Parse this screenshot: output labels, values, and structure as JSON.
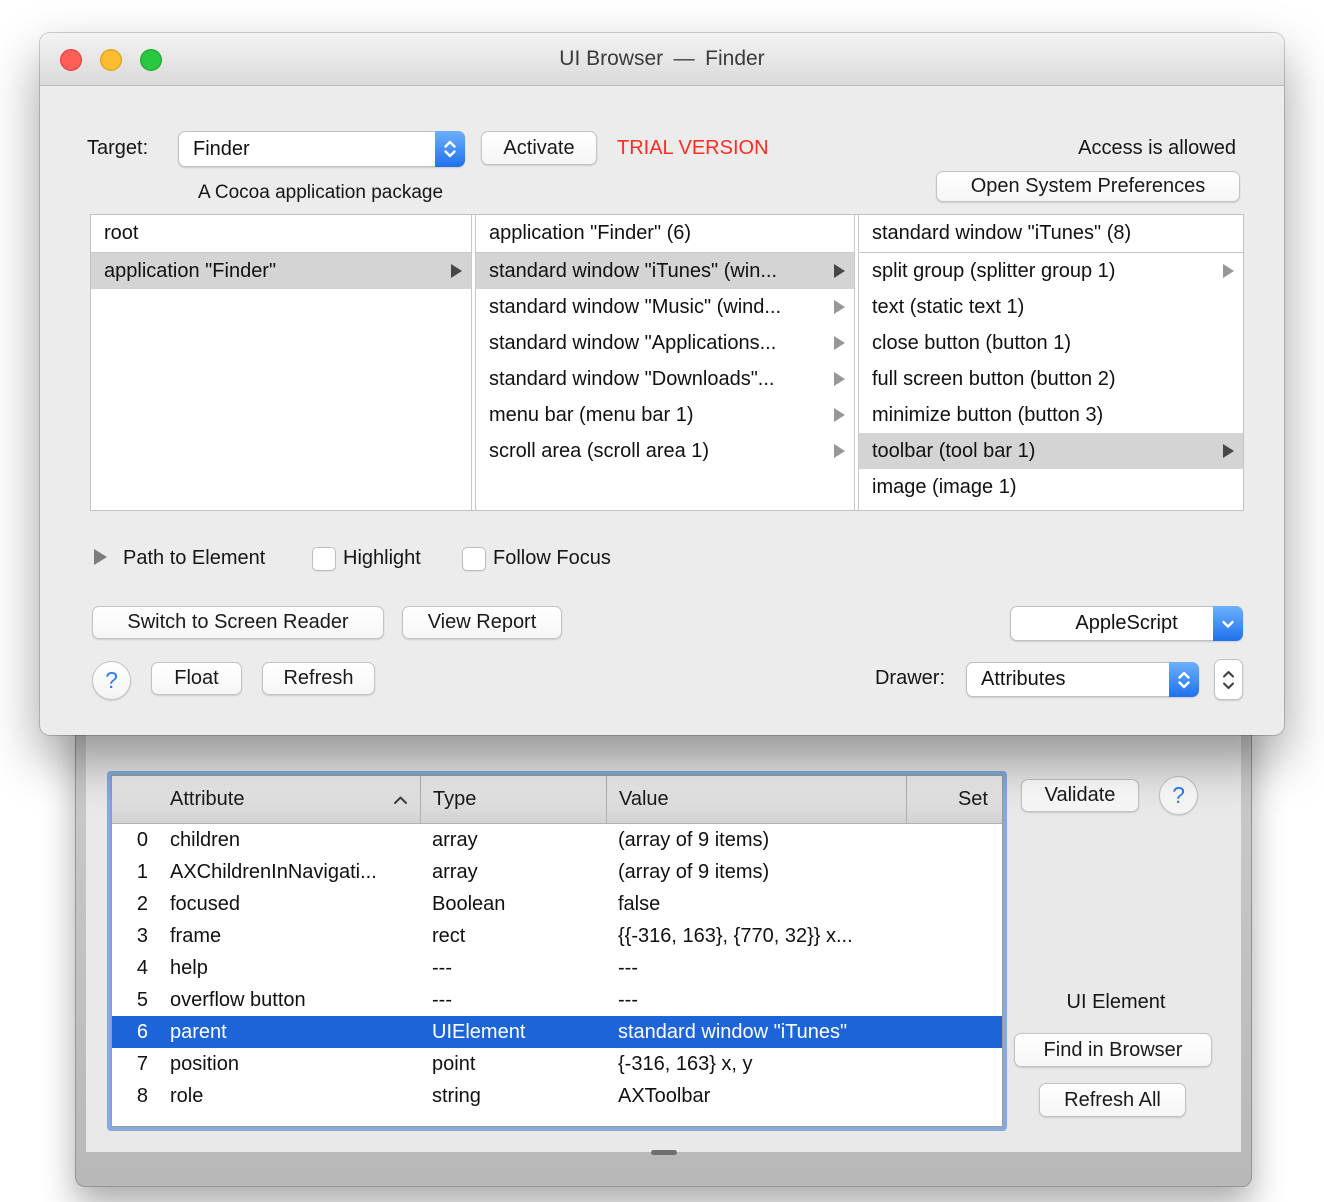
{
  "window": {
    "title": "UI Browser — Finder"
  },
  "target_bar": {
    "target_label": "Target:",
    "target_value": "Finder",
    "activate": "Activate",
    "trial": "TRIAL VERSION",
    "access": "Access is allowed",
    "caption": "A Cocoa application package",
    "open_prefs": "Open System Preferences"
  },
  "browser": {
    "col1": {
      "header": "root",
      "items": [
        {
          "label": "application \"Finder\"",
          "selected": true,
          "has_arrow": true
        }
      ]
    },
    "col2": {
      "header": "application \"Finder\" (6)",
      "items": [
        {
          "label": "standard window \"iTunes\" (win...",
          "selected": true,
          "has_arrow": true
        },
        {
          "label": "standard window \"Music\" (wind...",
          "selected": false,
          "has_arrow": true
        },
        {
          "label": "standard window \"Applications...",
          "selected": false,
          "has_arrow": true
        },
        {
          "label": "standard window \"Downloads\"...",
          "selected": false,
          "has_arrow": true
        },
        {
          "label": "menu bar (menu bar 1)",
          "selected": false,
          "has_arrow": true
        },
        {
          "label": "scroll area (scroll area 1)",
          "selected": false,
          "has_arrow": true
        }
      ]
    },
    "col3": {
      "header": "standard window \"iTunes\" (8)",
      "items": [
        {
          "label": "split group (splitter group 1)",
          "selected": false,
          "has_arrow": true
        },
        {
          "label": "text (static text 1)",
          "selected": false,
          "has_arrow": false
        },
        {
          "label": "close button (button 1)",
          "selected": false,
          "has_arrow": false
        },
        {
          "label": "full screen button (button 2)",
          "selected": false,
          "has_arrow": false
        },
        {
          "label": "minimize button (button 3)",
          "selected": false,
          "has_arrow": false
        },
        {
          "label": "toolbar (tool bar 1)",
          "selected": true,
          "has_arrow": true
        },
        {
          "label": "image (image 1)",
          "selected": false,
          "has_arrow": false
        }
      ]
    }
  },
  "path_row": {
    "path_to_element": "Path to Element",
    "highlight": "Highlight",
    "follow_focus": "Follow Focus"
  },
  "controls": {
    "switch_reader": "Switch to Screen Reader",
    "view_report": "View Report",
    "applescript": "AppleScript",
    "help": "?",
    "float": "Float",
    "refresh": "Refresh",
    "drawer_label": "Drawer:",
    "drawer_value": "Attributes"
  },
  "drawer": {
    "table": {
      "headers": {
        "attribute": "Attribute",
        "type": "Type",
        "value": "Value",
        "set": "Set"
      },
      "rows": [
        {
          "index": "0",
          "attribute": "children",
          "type": "array",
          "value": "(array of 9 items)",
          "selected": false
        },
        {
          "index": "1",
          "attribute": "AXChildrenInNavigati...",
          "type": "array",
          "value": "(array of 9 items)",
          "selected": false
        },
        {
          "index": "2",
          "attribute": "focused",
          "type": "Boolean",
          "value": "false",
          "selected": false
        },
        {
          "index": "3",
          "attribute": "frame",
          "type": "rect",
          "value": "{{-316, 163}, {770, 32}} x...",
          "selected": false
        },
        {
          "index": "4",
          "attribute": "help",
          "type": "---",
          "value": "---",
          "selected": false
        },
        {
          "index": "5",
          "attribute": "overflow button",
          "type": "---",
          "value": "---",
          "selected": false
        },
        {
          "index": "6",
          "attribute": "parent",
          "type": "UIElement",
          "value": "standard window \"iTunes\"",
          "selected": true
        },
        {
          "index": "7",
          "attribute": "position",
          "type": "point",
          "value": "{-316, 163} x, y",
          "selected": false
        },
        {
          "index": "8",
          "attribute": "role",
          "type": "string",
          "value": "AXToolbar",
          "selected": false
        }
      ]
    },
    "validate": "Validate",
    "help": "?",
    "ui_element": "UI Element",
    "find_in_browser": "Find in Browser",
    "refresh_all": "Refresh All"
  },
  "colors": {
    "selection_blue": "#1d64d8",
    "selection_gray": "#d4d4d4",
    "trial_red": "#fb2e21",
    "focus_ring": "#84abdc",
    "popup_blue": "#2f7cf6",
    "traffic_red": "#ff5f57",
    "traffic_yellow": "#febc2e",
    "traffic_green": "#28c840"
  }
}
